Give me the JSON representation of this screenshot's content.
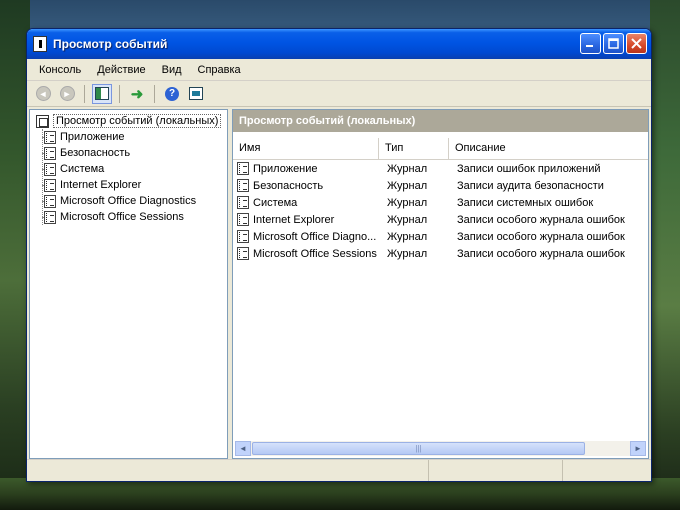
{
  "window": {
    "title": "Просмотр событий"
  },
  "menu": [
    "Консоль",
    "Действие",
    "Вид",
    "Справка"
  ],
  "toolbar": {
    "back": "back-icon",
    "forward": "forward-icon",
    "show_hide_tree": "show-hide-tree-icon",
    "export": "export-icon",
    "help": "help-icon",
    "properties": "properties-icon"
  },
  "tree": {
    "root": "Просмотр событий (локальных)",
    "items": [
      "Приложение",
      "Безопасность",
      "Система",
      "Internet Explorer",
      "Microsoft Office Diagnostics",
      "Microsoft Office Sessions"
    ]
  },
  "panel": {
    "header": "Просмотр событий (локальных)",
    "columns": [
      "Имя",
      "Тип",
      "Описание"
    ],
    "rows": [
      {
        "name": "Приложение",
        "type": "Журнал",
        "desc": "Записи ошибок приложений"
      },
      {
        "name": "Безопасность",
        "type": "Журнал",
        "desc": "Записи аудита безопасности"
      },
      {
        "name": "Система",
        "type": "Журнал",
        "desc": "Записи системных ошибок"
      },
      {
        "name": "Internet Explorer",
        "type": "Журнал",
        "desc": "Записи особого журнала ошибок"
      },
      {
        "name": "Microsoft Office Diagno...",
        "type": "Журнал",
        "desc": "Записи особого журнала ошибок"
      },
      {
        "name": "Microsoft Office Sessions",
        "type": "Журнал",
        "desc": "Записи особого журнала ошибок"
      }
    ]
  }
}
